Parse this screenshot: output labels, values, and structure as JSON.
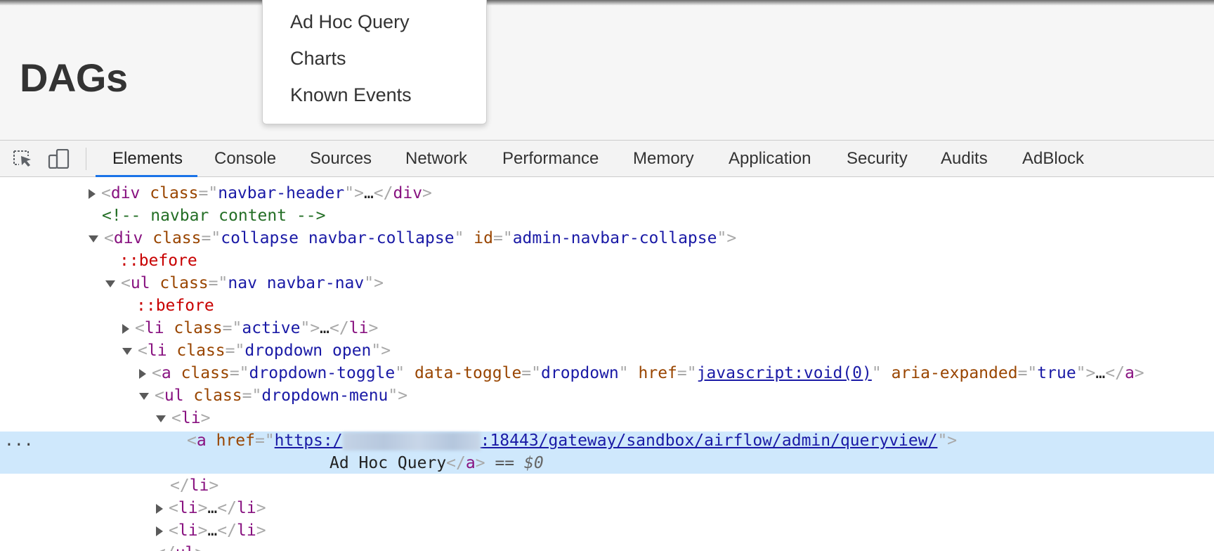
{
  "page": {
    "title": "DAGs",
    "dropdown_items": [
      "Ad Hoc Query",
      "Charts",
      "Known Events"
    ]
  },
  "devtools": {
    "tools": [
      "inspect-element-icon",
      "device-toolbar-icon"
    ],
    "tabs": [
      "Elements",
      "Console",
      "Sources",
      "Network",
      "Performance",
      "Memory",
      "Application",
      "Security",
      "Audits",
      "AdBlock"
    ],
    "active_tab": "Elements",
    "accent_color": "#1a73e8"
  },
  "dom": {
    "navbar_header": {
      "tag": "div",
      "attr": "class",
      "value": "navbar-header"
    },
    "comment": "<!-- navbar content -->",
    "collapse": {
      "tag": "div",
      "attr1": "class",
      "val1": "collapse navbar-collapse",
      "attr2": "id",
      "val2": "admin-navbar-collapse"
    },
    "before": "::before",
    "ul_nav": {
      "tag": "ul",
      "attr": "class",
      "value": "nav navbar-nav"
    },
    "li_active": {
      "tag": "li",
      "attr": "class",
      "value": "active"
    },
    "li_dropdown": {
      "tag": "li",
      "attr": "class",
      "value": "dropdown open"
    },
    "a_toggle": {
      "tag": "a",
      "a1": "class",
      "v1": "dropdown-toggle",
      "a2": "data-toggle",
      "v2": "dropdown",
      "a3": "href",
      "v3": "javascript:void(0)",
      "a4": "aria-expanded",
      "v4": "true"
    },
    "ul_menu": {
      "tag": "ul",
      "attr": "class",
      "value": "dropdown-menu"
    },
    "li": "li",
    "selected_a": {
      "tag": "a",
      "attr": "href",
      "url_prefix": "https:/",
      "url_suffix": ":18443/gateway/sandbox/airflow/admin/queryview/",
      "text": "Ad Hoc Query",
      "eq": "==",
      "dollar": "$0"
    },
    "ellipsis": "…",
    "gutter_dots": "..."
  }
}
